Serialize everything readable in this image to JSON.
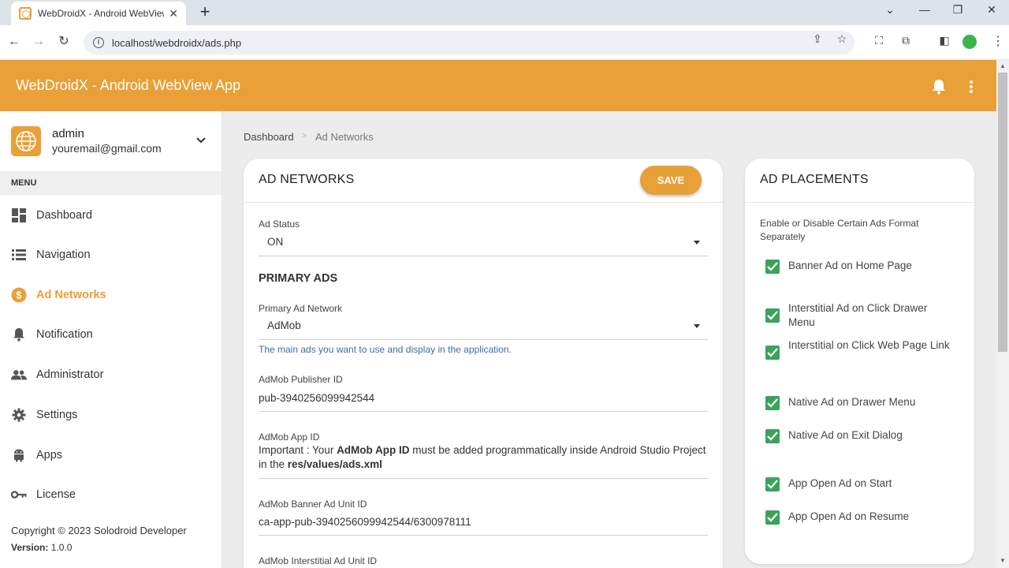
{
  "browser": {
    "tab_title": "WebDroidX - Android WebView",
    "tab_close": "✕",
    "new_tab": "+",
    "url": "localhost/webdroidx/ads.php"
  },
  "app": {
    "title": "WebDroidX - Android WebView App",
    "accent_color": "#e8a037"
  },
  "sidebar": {
    "user_name": "admin",
    "user_email": "youremail@gmail.com",
    "menu_header": "MENU",
    "items": [
      {
        "label": "Dashboard",
        "icon": "dashboard-icon"
      },
      {
        "label": "Navigation",
        "icon": "list-icon"
      },
      {
        "label": "Ad Networks",
        "icon": "dollar-icon",
        "active": true
      },
      {
        "label": "Notification",
        "icon": "bell-icon"
      },
      {
        "label": "Administrator",
        "icon": "people-icon"
      },
      {
        "label": "Settings",
        "icon": "gear-icon"
      },
      {
        "label": "Apps",
        "icon": "android-icon"
      },
      {
        "label": "License",
        "icon": "key-icon"
      }
    ],
    "copyright": "Copyright © 2023 Solodroid Developer",
    "version_label": "Version:",
    "version_value": "1.0.0"
  },
  "breadcrumb": {
    "home": "Dashboard",
    "separator": ">",
    "current": "Ad Networks"
  },
  "ad_networks": {
    "title": "AD NETWORKS",
    "save_label": "SAVE",
    "ad_status_label": "Ad Status",
    "ad_status_value": "ON",
    "primary_section": "PRIMARY ADS",
    "primary_network_label": "Primary Ad Network",
    "primary_network_value": "AdMob",
    "primary_helper": "The main ads you want to use and display in the application.",
    "publisher_id_label": "AdMob Publisher ID",
    "publisher_id_value": "pub-3940256099942544",
    "app_id_label": "AdMob App ID",
    "app_id_note_prefix": "Important : Your ",
    "app_id_note_bold": "AdMob App ID",
    "app_id_note_mid": " must be added programmatically inside Android Studio Project in the ",
    "app_id_note_path": "res/values/ads.xml",
    "banner_label": "AdMob Banner Ad Unit ID",
    "banner_value": "ca-app-pub-3940256099942544/6300978111",
    "interstitial_label": "AdMob Interstitial Ad Unit ID"
  },
  "ad_placements": {
    "title": "AD PLACEMENTS",
    "description": "Enable or Disable Certain Ads Format Separately",
    "check_color": "#3aa35a",
    "items": [
      {
        "label": "Banner Ad on Home Page",
        "checked": true
      },
      {
        "label": "Interstitial Ad on Click Drawer Menu",
        "checked": true
      },
      {
        "label": "Interstitial on Click Web Page Link",
        "checked": true
      },
      {
        "label": "Native Ad on Drawer Menu",
        "checked": true
      },
      {
        "label": "Native Ad on Exit Dialog",
        "checked": true
      },
      {
        "label": "App Open Ad on Start",
        "checked": true
      },
      {
        "label": "App Open Ad on Resume",
        "checked": true
      }
    ]
  }
}
